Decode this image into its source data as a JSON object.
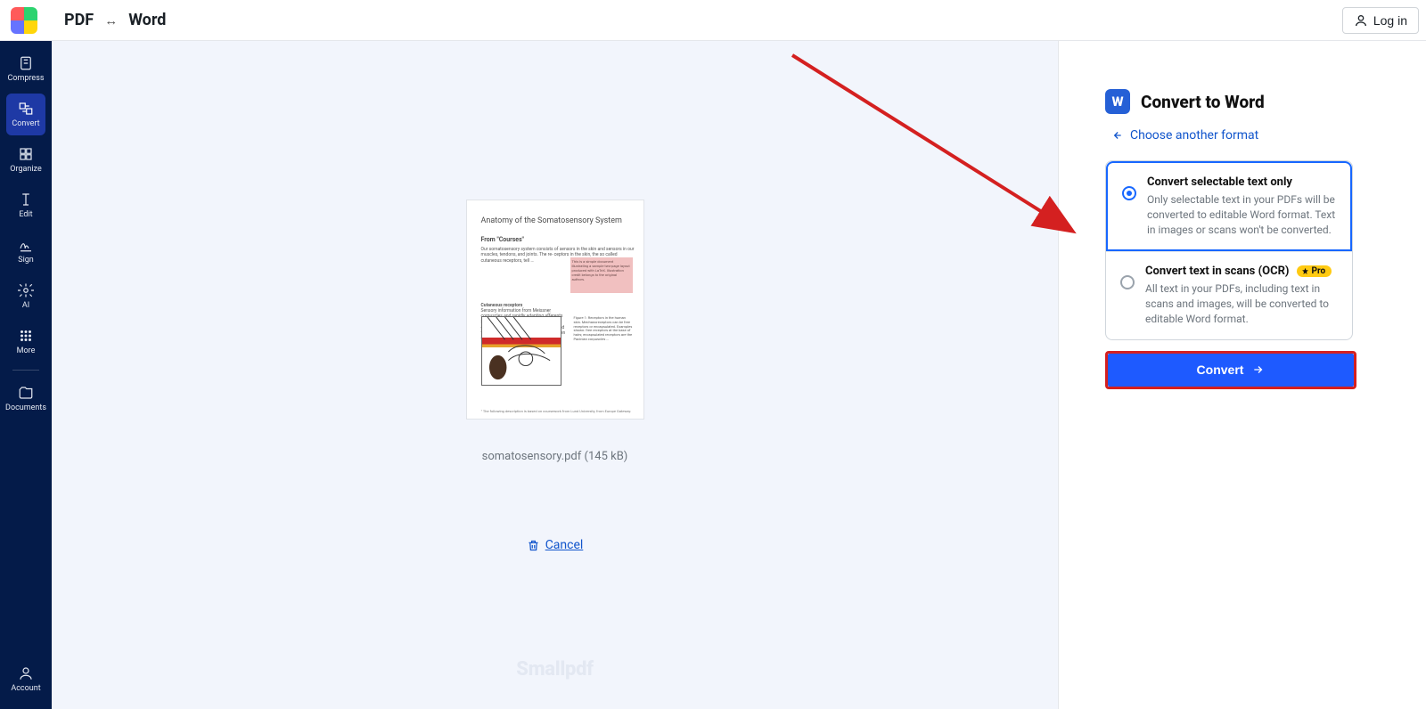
{
  "header": {
    "breadcrumb_left": "PDF",
    "breadcrumb_sep": "↔",
    "breadcrumb_right": "Word",
    "login_label": "Log in"
  },
  "sidebar": {
    "items": [
      {
        "key": "compress",
        "label": "Compress"
      },
      {
        "key": "convert",
        "label": "Convert"
      },
      {
        "key": "organize",
        "label": "Organize"
      },
      {
        "key": "edit",
        "label": "Edit"
      },
      {
        "key": "sign",
        "label": "Sign"
      },
      {
        "key": "ai",
        "label": "AI"
      },
      {
        "key": "more",
        "label": "More"
      },
      {
        "key": "documents",
        "label": "Documents"
      }
    ],
    "account_label": "Account"
  },
  "workspace": {
    "doc_title": "Anatomy of the Somatosensory System",
    "doc_subtitle": "From \"Courses\"",
    "file_name": "somatosensory.pdf",
    "file_size": "(145 kB)",
    "cancel_label": "Cancel",
    "brand": "Smallpdf"
  },
  "panel": {
    "word_letter": "W",
    "title": "Convert to Word",
    "choose_label": "Choose another format",
    "options": [
      {
        "title": "Convert selectable text only",
        "desc": "Only selectable text in your PDFs will be converted to editable Word format. Text in images or scans won't be converted.",
        "selected": true
      },
      {
        "title": "Convert text in scans (OCR)",
        "desc": "All text in your PDFs, including text in scans and images, will be converted to editable Word format.",
        "pro_label": "Pro",
        "selected": false
      }
    ],
    "convert_label": "Convert"
  }
}
